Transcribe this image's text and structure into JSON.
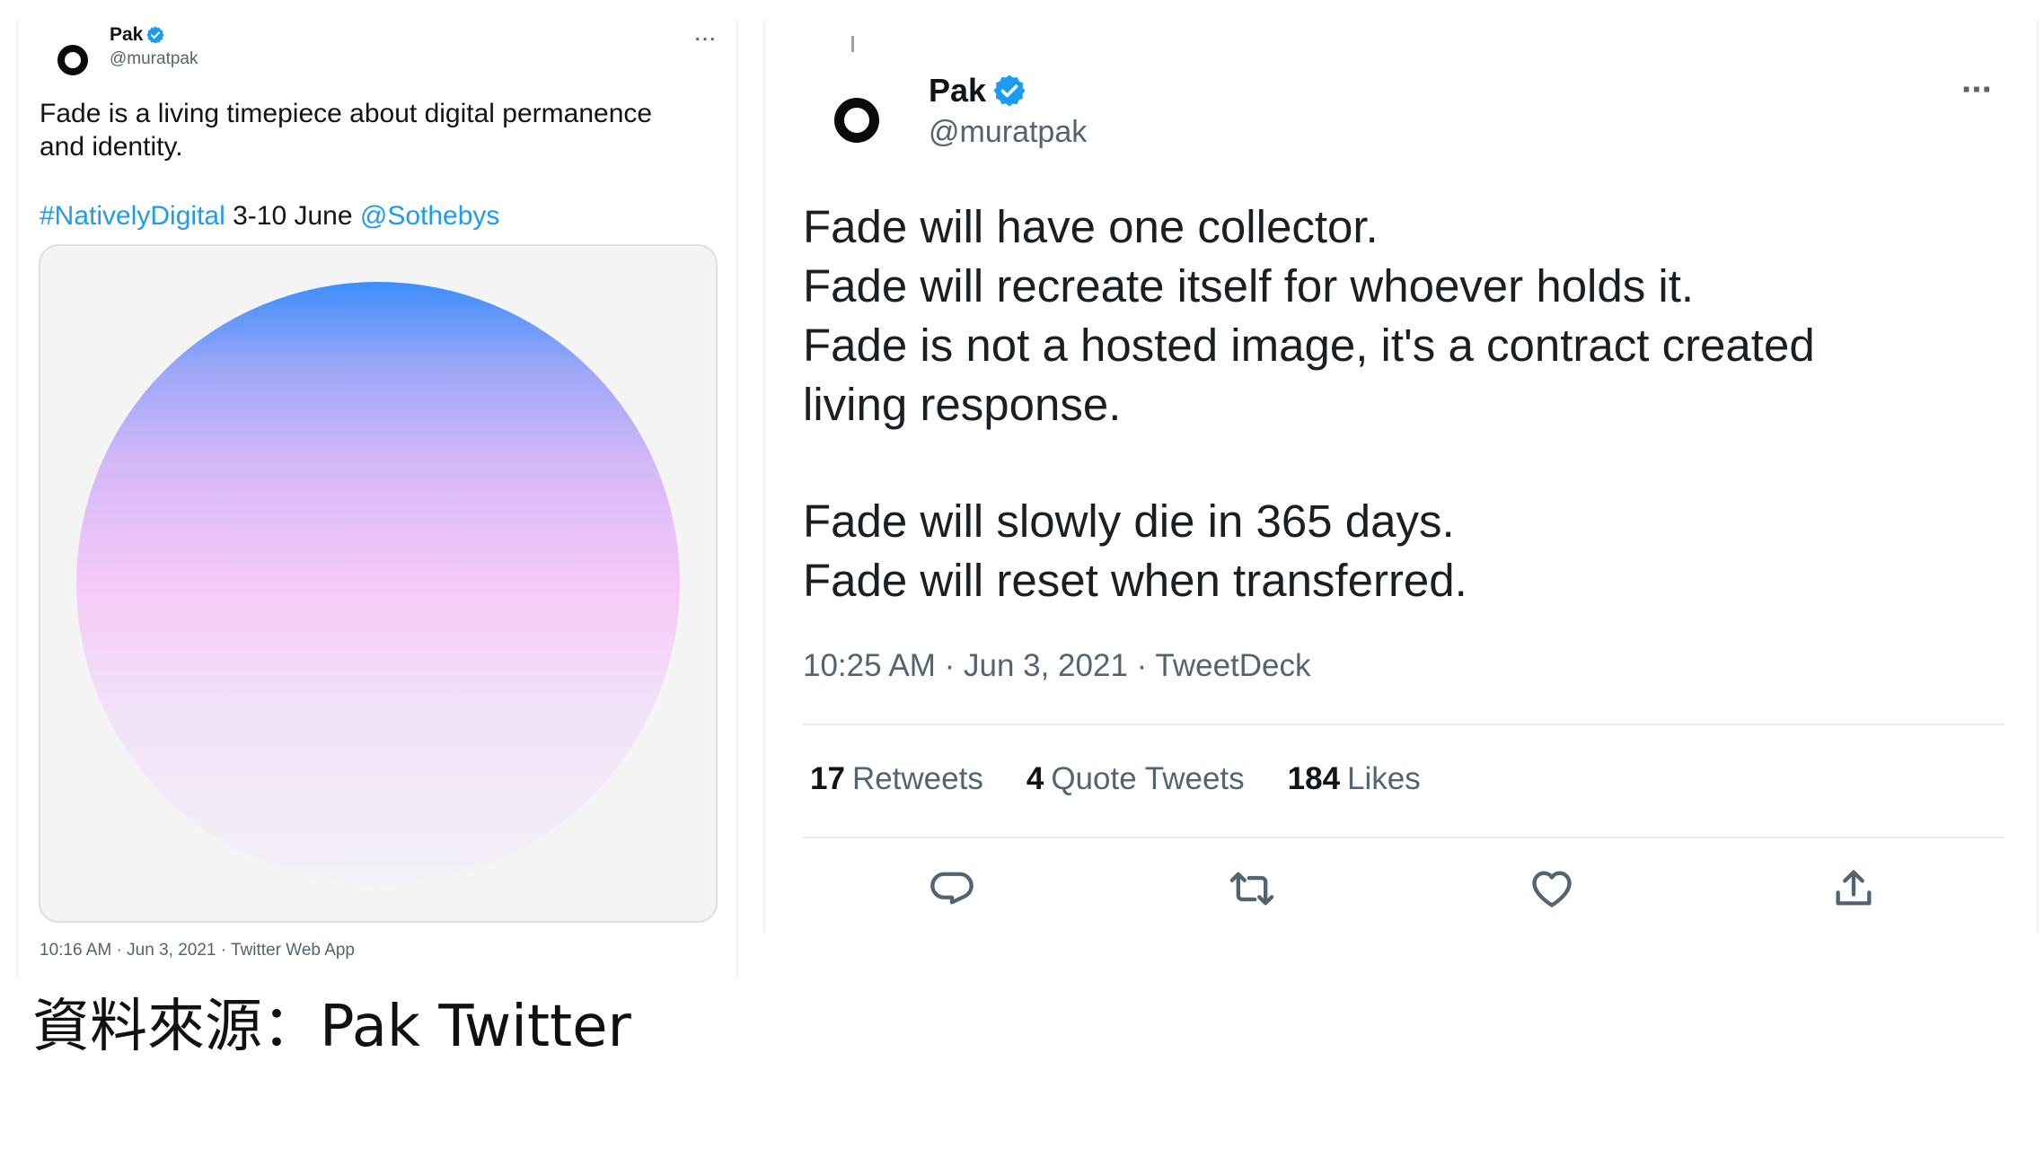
{
  "left_tweet": {
    "display_name": "Pak",
    "handle": "@muratpak",
    "more_label": "···",
    "text": "Fade is a living timepiece about digital permanence and identity.",
    "hashtag": "#NativelyDigital",
    "date_text": " 3-10 June ",
    "mention": "@Sothebys",
    "footer": "10:16 AM · Jun 3, 2021 · Twitter Web App",
    "media_colors": [
      "#3d8dfb",
      "#9aa6f7",
      "#f6c9f8",
      "#f3f1f7"
    ]
  },
  "right_tweet": {
    "display_name": "Pak",
    "handle": "@muratpak",
    "more_label": "···",
    "lines": [
      "Fade will have one collector.",
      "Fade will recreate itself for whoever holds it.",
      "Fade is not a hosted image, it's a contract created",
      "living response.",
      "Fade will slowly die in 365 days.",
      "Fade will reset when transferred."
    ],
    "meta": "10:25 AM · Jun 3, 2021 · TweetDeck",
    "stats": [
      {
        "count": "17",
        "label": "Retweets"
      },
      {
        "count": "4",
        "label": "Quote Tweets"
      },
      {
        "count": "184",
        "label": "Likes"
      }
    ],
    "actions": [
      "reply-icon",
      "retweet-icon",
      "like-icon",
      "share-icon"
    ]
  },
  "caption": "資料來源：Pak Twitter",
  "colors": {
    "link": "#1d9bf0",
    "verified": "#1d9bf0",
    "secondary_text": "#536471"
  }
}
